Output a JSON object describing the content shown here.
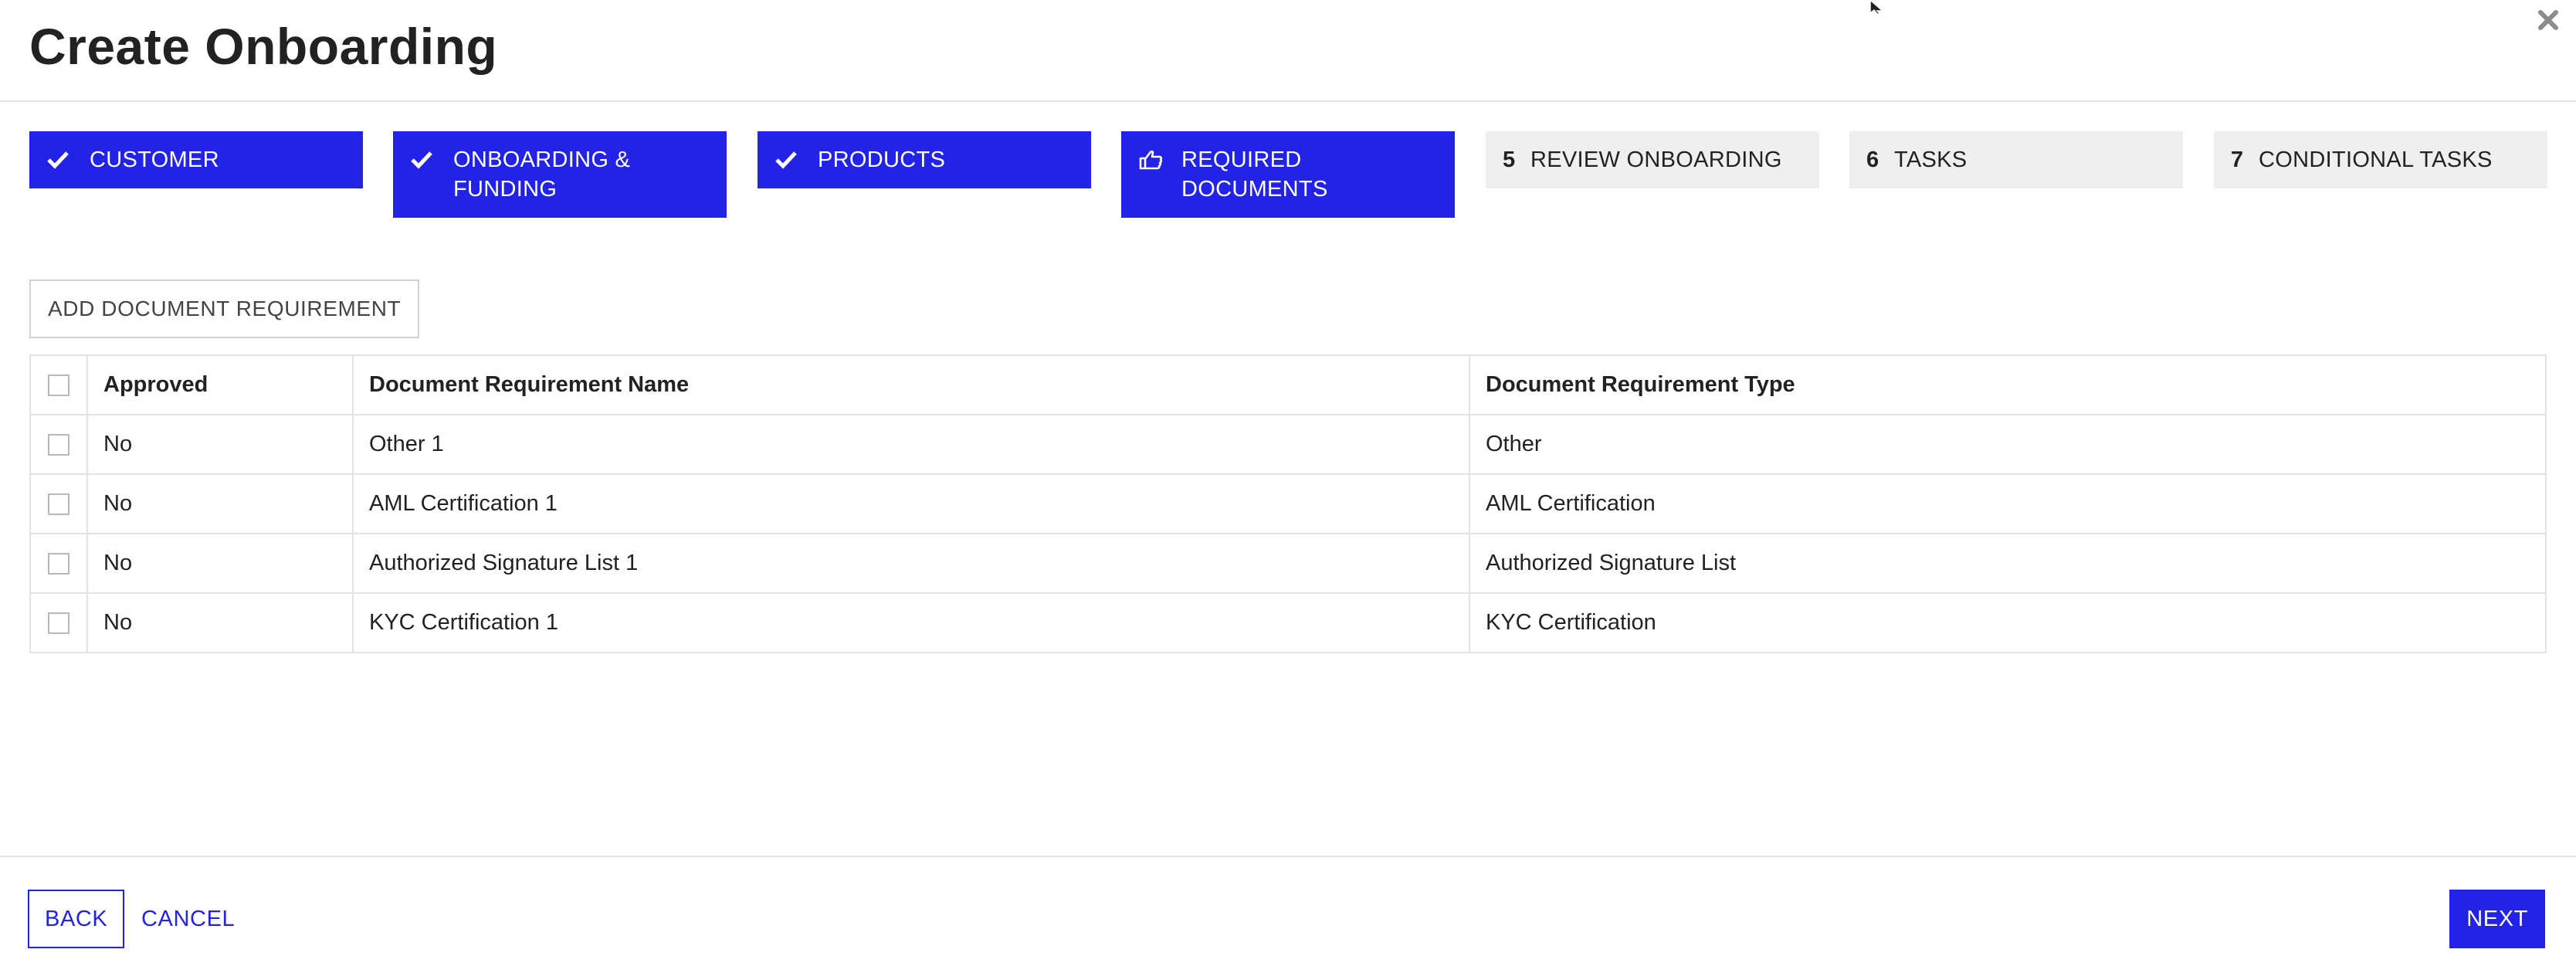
{
  "header": {
    "title": "Create Onboarding",
    "close_icon": "close-icon"
  },
  "steps": [
    {
      "label": "CUSTOMER",
      "state": "done",
      "icon": "check-icon"
    },
    {
      "label": "ONBOARDING & FUNDING",
      "state": "done",
      "icon": "check-icon"
    },
    {
      "label": "PRODUCTS",
      "state": "done",
      "icon": "check-icon"
    },
    {
      "label": "REQUIRED DOCUMENTS",
      "state": "current",
      "icon": "pointing-hand-icon"
    },
    {
      "number": "5",
      "label": "REVIEW ONBOARDING",
      "state": "todo"
    },
    {
      "number": "6",
      "label": "TASKS",
      "state": "todo"
    },
    {
      "number": "7",
      "label": "CONDITIONAL TASKS",
      "state": "todo"
    }
  ],
  "toolbar": {
    "add_label": "ADD DOCUMENT REQUIREMENT"
  },
  "table": {
    "columns": [
      "Approved",
      "Document Requirement Name",
      "Document Requirement Type"
    ],
    "rows": [
      {
        "approved": "No",
        "name": "Other 1",
        "type": "Other"
      },
      {
        "approved": "No",
        "name": "AML Certification 1",
        "type": "AML Certification"
      },
      {
        "approved": "No",
        "name": "Authorized Signature List 1",
        "type": "Authorized Signature List"
      },
      {
        "approved": "No",
        "name": "KYC Certification 1",
        "type": "KYC Certification"
      }
    ]
  },
  "footer": {
    "back_label": "BACK",
    "cancel_label": "CANCEL",
    "next_label": "NEXT"
  },
  "colors": {
    "accent": "#2323e8",
    "step_todo_bg": "#efefef",
    "border": "#e3e3e3"
  }
}
